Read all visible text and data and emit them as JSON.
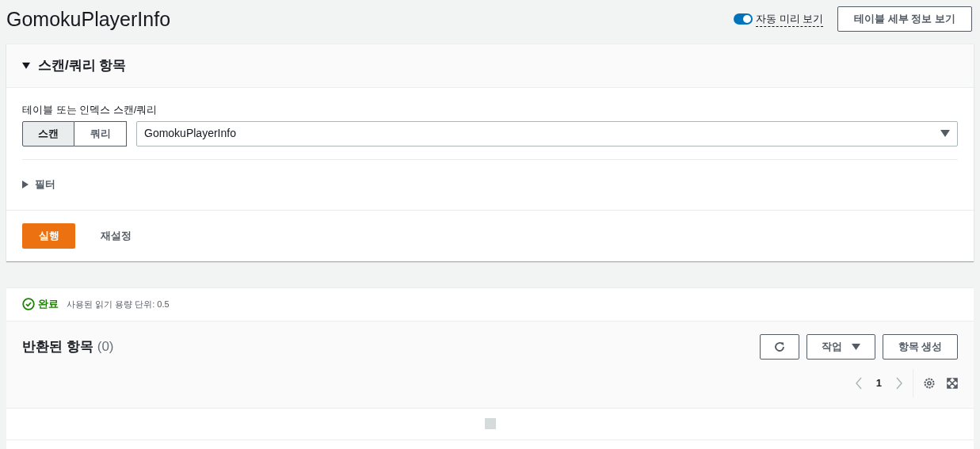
{
  "title": "GomokuPlayerInfo",
  "auto_preview": {
    "label": "자동 미리 보기",
    "on": true
  },
  "details_button": "테이블 세부 정보 보기",
  "scan_panel": {
    "title": "스캔/쿼리 항목",
    "expanded": true,
    "field_label": "테이블 또는 인덱스 스캔/쿼리",
    "modes": [
      {
        "label": "스캔",
        "selected": true
      },
      {
        "label": "쿼리",
        "selected": false
      }
    ],
    "table_select": "GomokuPlayerInfo",
    "filter": {
      "label": "필터",
      "expanded": false
    },
    "run_button": "실행",
    "reset_button": "재설정"
  },
  "results": {
    "status": "완료",
    "capacity": "사용된 읽기 용량 단위: 0.5",
    "title": "반환된 항목",
    "count": "(0)",
    "actions_button": "작업",
    "create_button": "항목 생성",
    "page": "1"
  }
}
